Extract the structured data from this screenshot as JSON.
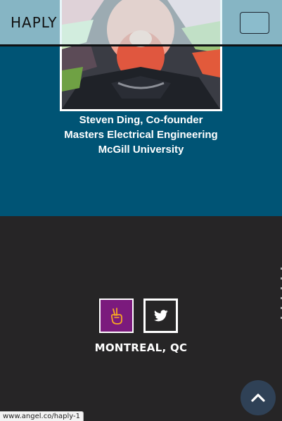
{
  "header": {
    "brand": "HAPLY",
    "menu_button_icon": "hamburger-menu-icon"
  },
  "profile": {
    "photo_icon": "founder-portrait-illustration",
    "name_line": "Steven Ding, Co-founder",
    "degree_line": "Masters Electrical Engineering",
    "school_line": "McGill University"
  },
  "footer": {
    "social": [
      {
        "icon": "angellist-peace-hand-icon",
        "color": "#7b1a7d"
      },
      {
        "icon": "twitter-bird-icon",
        "color": "#262526"
      }
    ],
    "location": "MONTREAL, QC",
    "scroll_top_icon": "chevron-up-icon"
  },
  "status_bar": {
    "url": "www.angel.co/haply-1"
  },
  "colors": {
    "hero_bg": "#005475",
    "footer_bg": "#262526",
    "angellist_bg": "#7b1a7d",
    "scroll_top_bg": "#2f4156"
  }
}
